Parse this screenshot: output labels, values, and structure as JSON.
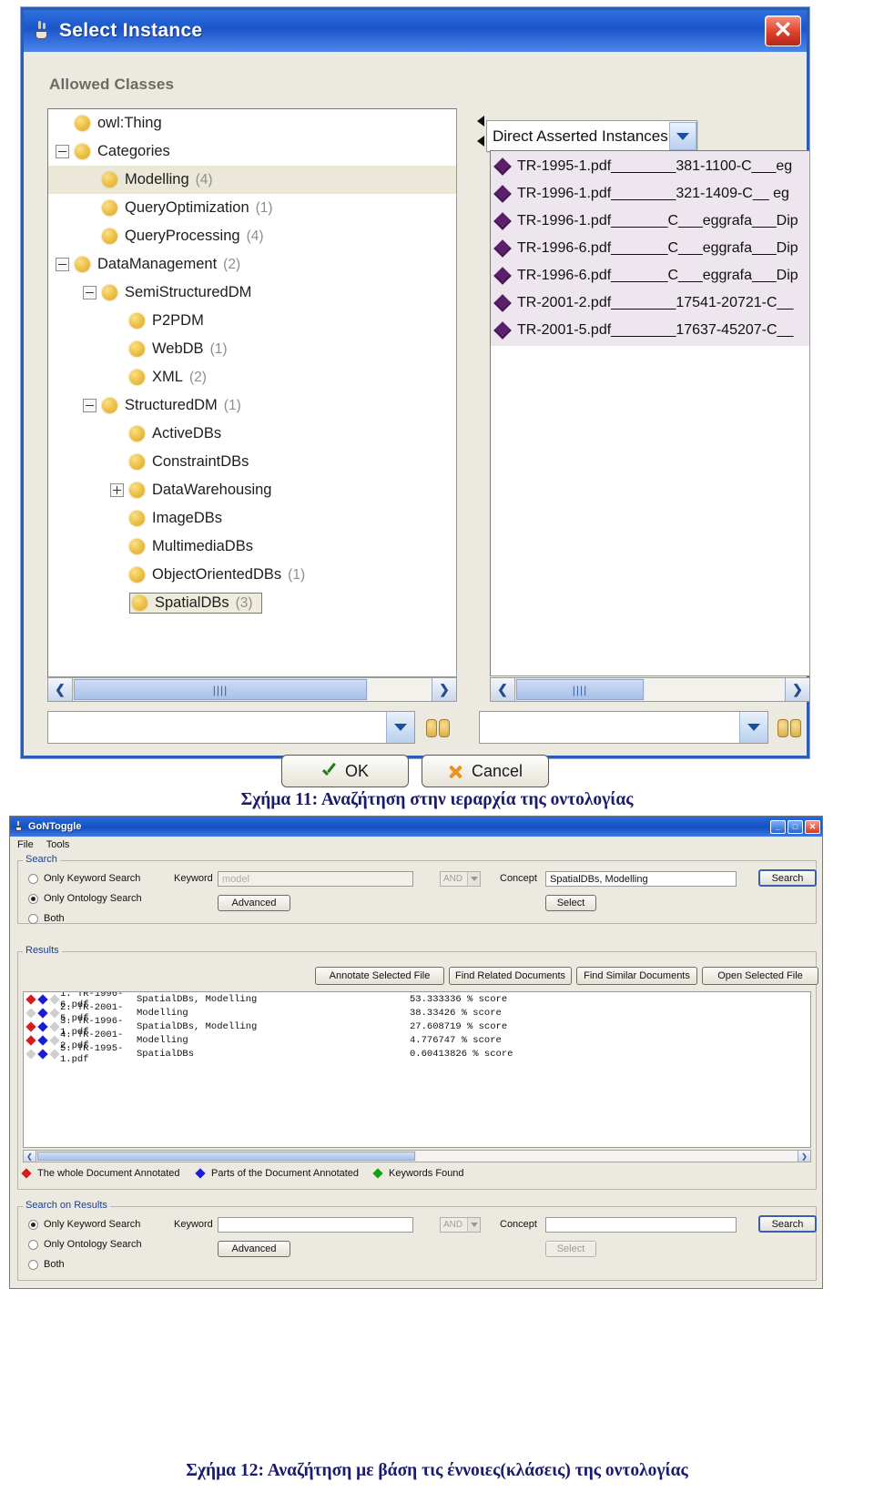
{
  "figure1": {
    "window_title": "Select Instance",
    "close_label": "✕",
    "allowed_classes_label": "Allowed Classes",
    "tree": [
      {
        "label": "owl:Thing",
        "count": "",
        "indent": 0,
        "toggle": "",
        "selected": false
      },
      {
        "label": "Categories",
        "count": "",
        "indent": 0,
        "toggle": "minus",
        "selected": false
      },
      {
        "label": "Modelling",
        "count": "(4)",
        "indent": 1,
        "toggle": "",
        "selected": true
      },
      {
        "label": "QueryOptimization",
        "count": "(1)",
        "indent": 1,
        "toggle": "",
        "selected": false
      },
      {
        "label": "QueryProcessing",
        "count": "(4)",
        "indent": 1,
        "toggle": "",
        "selected": false
      },
      {
        "label": "DataManagement",
        "count": "(2)",
        "indent": 0,
        "toggle": "minus",
        "selected": false
      },
      {
        "label": "SemiStructuredDM",
        "count": "",
        "indent": 1,
        "toggle": "minus",
        "selected": false
      },
      {
        "label": "P2PDM",
        "count": "",
        "indent": 2,
        "toggle": "",
        "selected": false
      },
      {
        "label": "WebDB",
        "count": "(1)",
        "indent": 2,
        "toggle": "",
        "selected": false
      },
      {
        "label": "XML",
        "count": "(2)",
        "indent": 2,
        "toggle": "",
        "selected": false
      },
      {
        "label": "StructuredDM",
        "count": "(1)",
        "indent": 1,
        "toggle": "minus",
        "selected": false
      },
      {
        "label": "ActiveDBs",
        "count": "",
        "indent": 2,
        "toggle": "",
        "selected": false
      },
      {
        "label": "ConstraintDBs",
        "count": "",
        "indent": 2,
        "toggle": "",
        "selected": false
      },
      {
        "label": "DataWarehousing",
        "count": "",
        "indent": 2,
        "toggle": "plus",
        "selected": false
      },
      {
        "label": "ImageDBs",
        "count": "",
        "indent": 2,
        "toggle": "",
        "selected": false
      },
      {
        "label": "MultimediaDBs",
        "count": "",
        "indent": 2,
        "toggle": "",
        "selected": false
      },
      {
        "label": "ObjectOrientedDBs",
        "count": "(1)",
        "indent": 2,
        "toggle": "",
        "selected": false
      },
      {
        "label": "SpatialDBs",
        "count": "(3)",
        "indent": 2,
        "toggle": "",
        "selected": false,
        "boxed": true
      }
    ],
    "instances_combo": "Direct Asserted Instances",
    "instances": [
      {
        "name": "TR-1995-1.pdf",
        "rest": "________381-1100-C___eg"
      },
      {
        "name": "TR-1996-1.pdf",
        "rest": "________321-1409-C__ eg"
      },
      {
        "name": "TR-1996-1.pdf",
        "rest": "_______C___eggrafa___Dip"
      },
      {
        "name": "TR-1996-6.pdf",
        "rest": "_______C___eggrafa___Dip"
      },
      {
        "name": "TR-1996-6.pdf",
        "rest": "_______C___eggrafa___Dip"
      },
      {
        "name": "TR-2001-2.pdf",
        "rest": "________17541-20721-C__"
      },
      {
        "name": "TR-2001-5.pdf",
        "rest": "________17637-45207-C__"
      }
    ],
    "left_search_value": "",
    "right_search_value": "",
    "ok_label": "OK",
    "cancel_label": "Cancel",
    "scroll_left_arrow": "❮",
    "scroll_right_arrow": "❯",
    "thumb_grip": "||||"
  },
  "caption1": "Σχήμα 11: Αναζήτηση στην ιεραρχία της οντολογίας",
  "caption2": "Σχήμα 12: Αναζήτηση με βάση τις έννοιες(κλάσεις) της οντολογίας",
  "figure2": {
    "window_title": "GoNToggle",
    "min_label": "_",
    "max_label": "□",
    "close_label": "✕",
    "menus": [
      "File",
      "Tools"
    ],
    "search": {
      "group_label": "Search",
      "radios": [
        {
          "label": "Only Keyword Search",
          "selected": false
        },
        {
          "label": "Only Ontology Search",
          "selected": true
        },
        {
          "label": "Both",
          "selected": false
        }
      ],
      "keyword_label": "Keyword",
      "keyword_value": "model",
      "advanced_label": "Advanced",
      "operator_value": "AND",
      "concept_label": "Concept",
      "concept_value": "SpatialDBs, Modelling",
      "select_label": "Select",
      "search_label": "Search"
    },
    "results": {
      "group_label": "Results",
      "buttons": [
        "Annotate Selected File",
        "Find Related Documents",
        "Find Similar Documents",
        "Open Selected File"
      ],
      "rows": [
        {
          "marks": [
            "red",
            "blue",
            "grey"
          ],
          "index": "1.",
          "file": "TR-1996-6.pdf",
          "concept": "SpatialDBs, Modelling",
          "score": "53.333336",
          "score_suffix": "% score"
        },
        {
          "marks": [
            "grey",
            "blue",
            "grey"
          ],
          "index": "2.",
          "file": "TR-2001-5.pdf",
          "concept": "Modelling",
          "score": "38.33426",
          "score_suffix": "% score"
        },
        {
          "marks": [
            "red",
            "blue",
            "grey"
          ],
          "index": "3.",
          "file": "TR-1996-1.pdf",
          "concept": "SpatialDBs, Modelling",
          "score": "27.608719",
          "score_suffix": "% score"
        },
        {
          "marks": [
            "red",
            "blue",
            "grey"
          ],
          "index": "4.",
          "file": "TR-2001-2.pdf",
          "concept": "Modelling",
          "score": "4.776747",
          "score_suffix": "% score"
        },
        {
          "marks": [
            "grey",
            "blue",
            "grey"
          ],
          "index": "5.",
          "file": "TR-1995-1.pdf",
          "concept": "SpatialDBs",
          "score": "0.60413826",
          "score_suffix": "% score"
        }
      ],
      "legend": [
        {
          "color": "red",
          "label": "The whole Document Annotated"
        },
        {
          "color": "blue",
          "label": "Parts of the Document Annotated"
        },
        {
          "color": "green",
          "label": "Keywords Found"
        }
      ]
    },
    "search_on_results": {
      "group_label": "Search on Results",
      "radios": [
        {
          "label": "Only Keyword Search",
          "selected": true
        },
        {
          "label": "Only Ontology Search",
          "selected": false
        },
        {
          "label": "Both",
          "selected": false
        }
      ],
      "keyword_label": "Keyword",
      "keyword_value": "",
      "advanced_label": "Advanced",
      "operator_value": "AND",
      "concept_label": "Concept",
      "concept_value": "",
      "select_label": "Select",
      "search_label": "Search"
    }
  }
}
